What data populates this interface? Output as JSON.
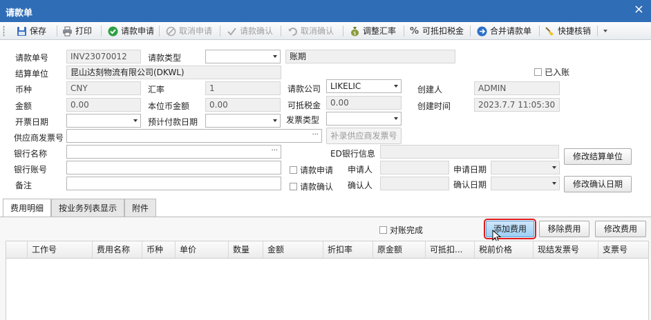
{
  "window": {
    "title": "请款单",
    "close_glyph": "×"
  },
  "toolbar": [
    {
      "label": "保存",
      "icon": "save-icon",
      "enabled": true
    },
    {
      "label": "打印",
      "icon": "print-icon",
      "enabled": true
    },
    {
      "label": "请款申请",
      "icon": "check-circle-icon",
      "enabled": true
    },
    {
      "label": "取消申请",
      "icon": "cancel-circle-icon",
      "enabled": false
    },
    {
      "label": "请款确认",
      "icon": "checkmark-icon",
      "enabled": false
    },
    {
      "label": "取消确认",
      "icon": "undo-icon",
      "enabled": false
    },
    {
      "label": "调整汇率",
      "icon": "money-bag-icon",
      "enabled": true
    },
    {
      "label": "可抵扣税金",
      "icon": "percent-icon",
      "enabled": true
    },
    {
      "label": "合并请款单",
      "icon": "merge-icon",
      "enabled": true
    },
    {
      "label": "快捷核销",
      "icon": "broom-icon",
      "enabled": true
    }
  ],
  "form": {
    "request_no_label": "请款单号",
    "request_no": "INV23070012",
    "request_type_label": "请款类型",
    "request_type": "",
    "period_text": "账期",
    "settle_unit_label": "结算单位",
    "settle_unit": "昆山达刻物流有限公司(DKWL)",
    "posted_label": "已入账",
    "currency_label": "币种",
    "currency": "CNY",
    "rate_label": "汇率",
    "rate": "1",
    "company_label": "请款公司",
    "company": "LIKELIC",
    "creator_label": "创建人",
    "creator": "ADMIN",
    "amount_label": "金额",
    "amount": "0.00",
    "local_amount_label": "本位币金额",
    "local_amount": "0.00",
    "deductible_tax_label": "可抵税金",
    "deductible_tax": "0.00",
    "created_time_label": "创建时间",
    "created_time": "2023.7.7 11:05:30",
    "invoice_date_label": "开票日期",
    "invoice_date": "",
    "expected_pay_date_label": "预计付款日期",
    "expected_pay_date": "",
    "invoice_type_label": "发票类型",
    "invoice_type": "",
    "supplier_invoice_label": "供应商发票号",
    "supplier_invoice": "",
    "supplement_invoice_btn": "补录供应商发票号",
    "bank_name_label": "银行名称",
    "bank_name": "",
    "ed_bank_label": "ED银行信息",
    "ed_bank": "",
    "modify_settle_btn": "修改结算单位",
    "bank_account_label": "银行账号",
    "bank_account": "",
    "apply_chk_label": "请款申请",
    "applicant_label": "申请人",
    "applicant": "",
    "apply_date_label": "申请日期",
    "apply_date": "",
    "remark_label": "备注",
    "remark": "",
    "confirm_chk_label": "请款确认",
    "confirmer_label": "确认人",
    "confirmer": "",
    "confirm_date_label": "确认日期",
    "confirm_date": "",
    "modify_confirm_date_btn": "修改确认日期",
    "ellipsis": "···"
  },
  "tabs": [
    "费用明细",
    "按业务列表显示",
    "附件"
  ],
  "detail": {
    "reconciled_label": "对账完成",
    "add_fee_btn": "添加费用",
    "remove_fee_btn": "移除费用",
    "edit_fee_btn": "修改费用",
    "columns": [
      "工作号",
      "费用名称",
      "币种",
      "单价",
      "数量",
      "金额",
      "折扣率",
      "原金额",
      "可抵扣...",
      "税前价格",
      "现结发票号",
      "支票号"
    ]
  },
  "colors": {
    "titlebar": "#2f6db6",
    "highlight_outline": "#e0191b",
    "add_button": "#9ccff4"
  }
}
